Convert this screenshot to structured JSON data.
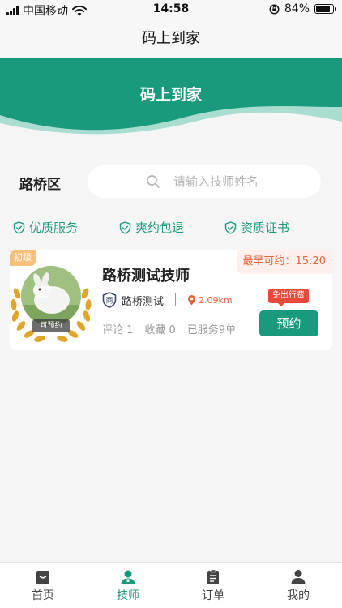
{
  "status_bar": {
    "carrier": "中国移动",
    "time": "14:58",
    "battery": "84%",
    "battery_level": 0.84
  },
  "nav": {
    "title": "码上到家"
  },
  "banner": {
    "title": "码上到家",
    "color": "#1a9a7d"
  },
  "search": {
    "area": "路桥区",
    "placeholder": "请输入技师姓名"
  },
  "features": [
    {
      "label": "优质服务",
      "icon": "shield-check-icon"
    },
    {
      "label": "爽约包退",
      "icon": "shield-check-icon"
    },
    {
      "label": "资质证书",
      "icon": "shield-check-icon"
    }
  ],
  "technician": {
    "level": "初级",
    "name": "路桥测试技师",
    "earliest": "最早可约：15:20",
    "avatar_status": "可预约",
    "shop_badge": "商",
    "shop_name": "路桥测试",
    "distance": "2.09km",
    "comments": "评论 1",
    "favorites": "收藏 0",
    "served": "已服务9单",
    "fee_badge": "免出行费",
    "book_label": "预约"
  },
  "tabbar": {
    "items": [
      {
        "label": "首页",
        "icon": "home-icon",
        "active": false
      },
      {
        "label": "技师",
        "icon": "technician-icon",
        "active": true
      },
      {
        "label": "订单",
        "icon": "order-icon",
        "active": false
      },
      {
        "label": "我的",
        "icon": "profile-icon",
        "active": false
      }
    ]
  },
  "colors": {
    "accent": "#1a9a7d",
    "warning": "#e8643a",
    "badge": "#e84b3c"
  }
}
